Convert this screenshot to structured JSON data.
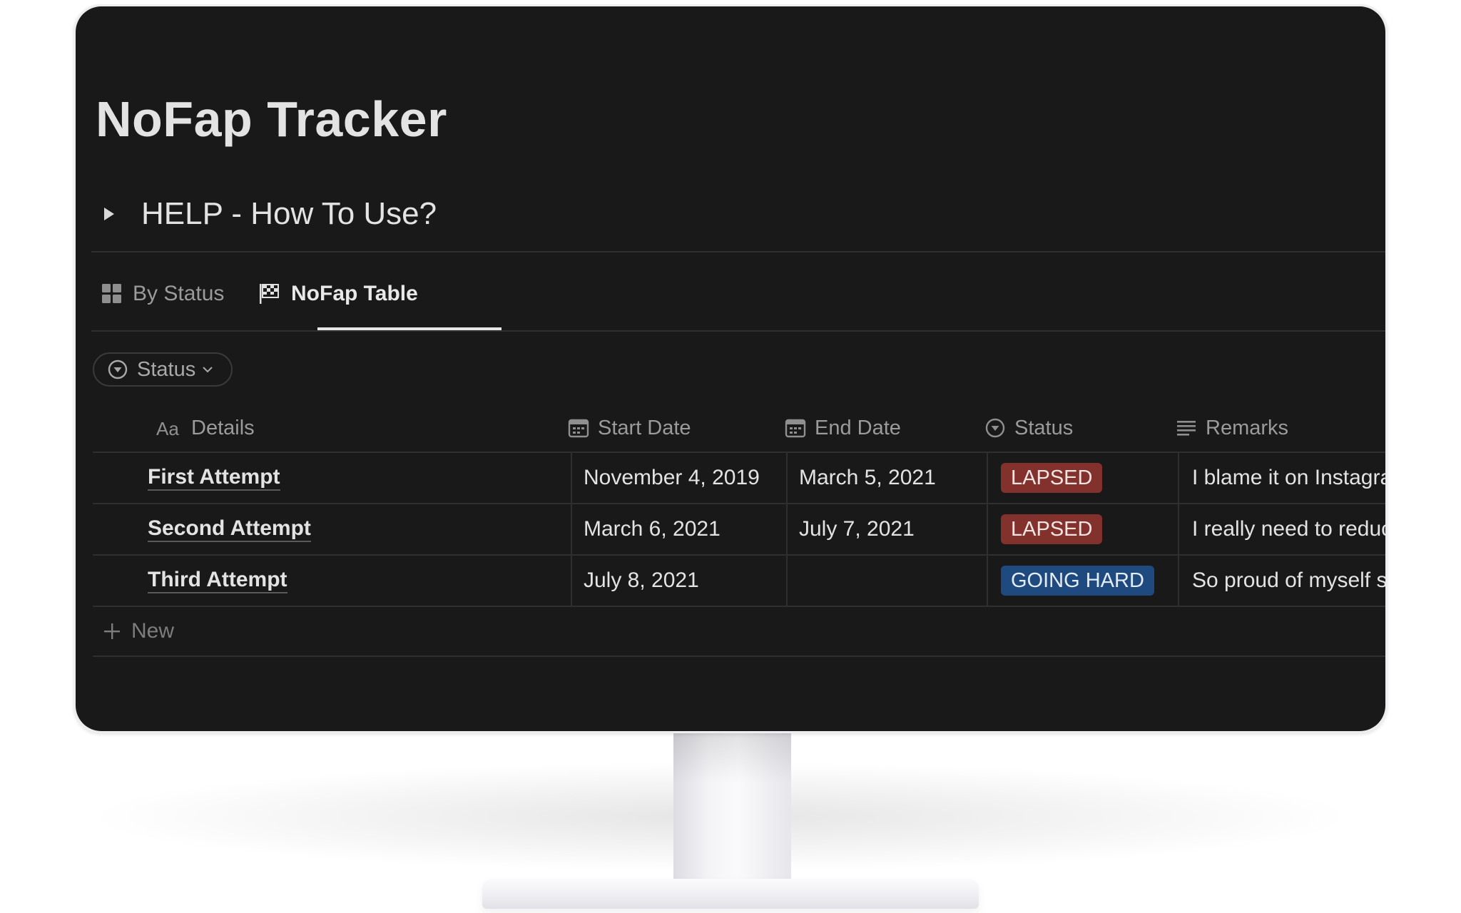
{
  "page": {
    "title": "NoFap Tracker",
    "toggle_heading": "HELP - How To Use?"
  },
  "tabs": [
    {
      "label": "By Status",
      "icon": "board-grid-icon",
      "active": false
    },
    {
      "label": "NoFap Table",
      "icon": "checkered-flag-icon",
      "active": true
    }
  ],
  "filter": {
    "label": "Status",
    "icon": "status-circle-icon"
  },
  "table": {
    "columns": [
      {
        "label": "Details",
        "icon": "text-aa-icon"
      },
      {
        "label": "Start Date",
        "icon": "calendar-icon"
      },
      {
        "label": "End Date",
        "icon": "calendar-icon"
      },
      {
        "label": "Status",
        "icon": "status-circle-icon"
      },
      {
        "label": "Remarks",
        "icon": "lines-icon"
      }
    ],
    "rows": [
      {
        "details": "First Attempt",
        "start": "November 4, 2019",
        "end": "March 5, 2021",
        "status": "LAPSED",
        "remarks": "I blame it on Instagram"
      },
      {
        "details": "Second Attempt",
        "start": "March 6, 2021",
        "end": "July 7, 2021",
        "status": "LAPSED",
        "remarks": "I really need to reduce"
      },
      {
        "details": "Third Attempt",
        "start": "July 8, 2021",
        "end": "",
        "status": "GOING HARD",
        "remarks": "So proud of myself still"
      }
    ],
    "new_label": "New"
  },
  "colors": {
    "background": "#191919",
    "lapsed": "#83312c",
    "going_hard": "#1f4a80",
    "text": "#e3e3e3",
    "muted": "#9b9b9b"
  }
}
